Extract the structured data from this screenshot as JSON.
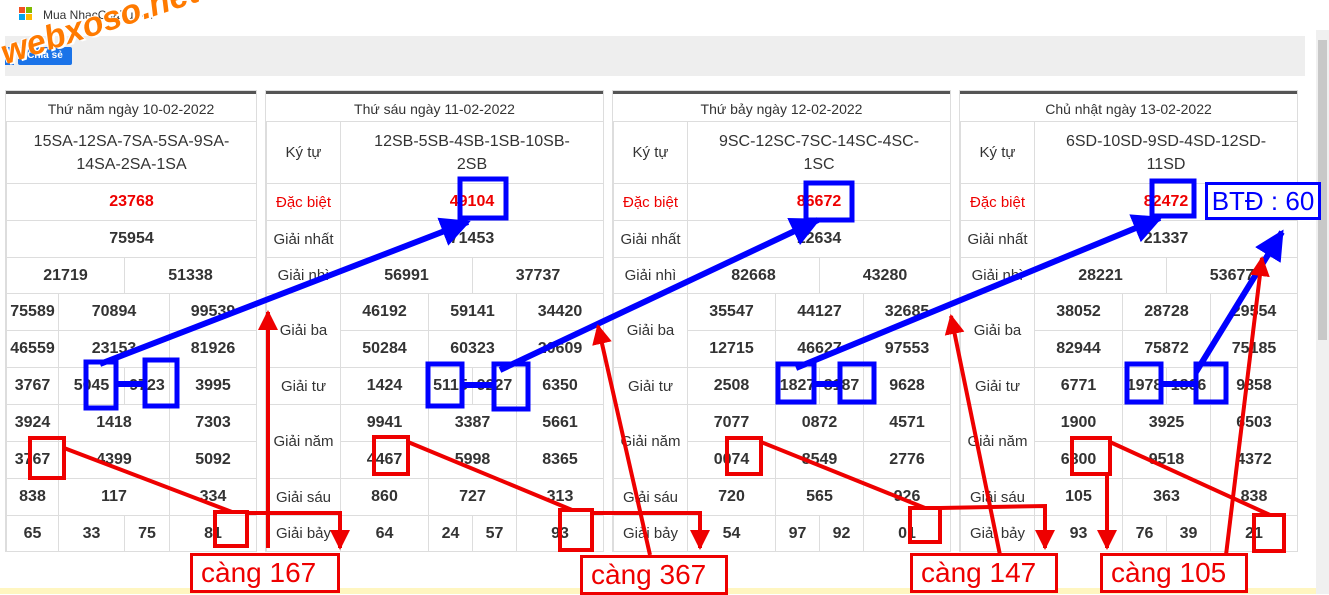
{
  "window": {
    "title": "Mua NhacCuaTui -..."
  },
  "toolbar": {
    "share_label": "Chia sẻ"
  },
  "watermark": "webxoso.net",
  "labels": {
    "ky_tu": "Ký tự",
    "dac_biet": "Đặc biệt",
    "giai_nhat": "Giải nhất",
    "giai_nhi": "Giải nhì",
    "giai_ba": "Giải ba",
    "giai_tu": "Giải tư",
    "giai_nam": "Giải năm",
    "giai_sau": "Giải sáu",
    "giai_bay": "Giải bảy"
  },
  "cards": [
    {
      "header": "Thứ năm ngày 10-02-2022",
      "kytu": "15SA-12SA-7SA-5SA-9SA-14SA-2SA-1SA",
      "db": "23768",
      "g1": "75954",
      "g2": [
        "21719",
        "51338"
      ],
      "g3": [
        "75589",
        "70894",
        "99539",
        "46559",
        "23153",
        "81926"
      ],
      "g4": [
        "3767",
        "5045",
        "9723",
        "3995"
      ],
      "g5": [
        "3924",
        "1418",
        "7303",
        "3767",
        "4399",
        "5092"
      ],
      "g6": [
        "838",
        "117",
        "334"
      ],
      "g7": [
        "65",
        "33",
        "75",
        "81"
      ]
    },
    {
      "header": "Thứ sáu ngày 11-02-2022",
      "kytu": "12SB-5SB-4SB-1SB-10SB-2SB",
      "db": "49104",
      "g1": "71453",
      "g2": [
        "56991",
        "37737"
      ],
      "g3": [
        "46192",
        "59141",
        "34420",
        "50284",
        "60323",
        "20609"
      ],
      "g4": [
        "1424",
        "5115",
        "9227",
        "6350"
      ],
      "g5": [
        "9941",
        "3387",
        "5661",
        "4467",
        "5998",
        "8365"
      ],
      "g6": [
        "860",
        "727",
        "313"
      ],
      "g7": [
        "64",
        "24",
        "57",
        "93"
      ]
    },
    {
      "header": "Thứ bảy ngày 12-02-2022",
      "kytu": "9SC-12SC-7SC-14SC-4SC-1SC",
      "db": "86672",
      "g1": "12634",
      "g2": [
        "82668",
        "43280"
      ],
      "g3": [
        "35547",
        "44127",
        "32685",
        "12715",
        "46627",
        "97553"
      ],
      "g4": [
        "2508",
        "1827",
        "8187",
        "9628"
      ],
      "g5": [
        "7077",
        "0872",
        "4571",
        "0074",
        "8549",
        "2776"
      ],
      "g6": [
        "720",
        "565",
        "926"
      ],
      "g7": [
        "54",
        "97",
        "92",
        "01"
      ]
    },
    {
      "header": "Chủ nhật ngày 13-02-2022",
      "kytu": "6SD-10SD-9SD-4SD-12SD-11SD",
      "db": "82472",
      "g1": "21337",
      "g2": [
        "28221",
        "53677"
      ],
      "g3": [
        "38052",
        "28728",
        "29554",
        "82944",
        "75872",
        "75185"
      ],
      "g4": [
        "6771",
        "1978",
        "1866",
        "9858"
      ],
      "g5": [
        "1900",
        "3925",
        "6503",
        "6800",
        "9518",
        "4372"
      ],
      "g6": [
        "105",
        "363",
        "838"
      ],
      "g7": [
        "93",
        "76",
        "39",
        "21"
      ]
    }
  ],
  "annotations": {
    "cang": [
      "càng 167",
      "càng 367",
      "càng 147",
      "càng 105"
    ],
    "btd": "BTĐ : 60",
    "red": "#ee0000",
    "blue": "#0000ff"
  }
}
